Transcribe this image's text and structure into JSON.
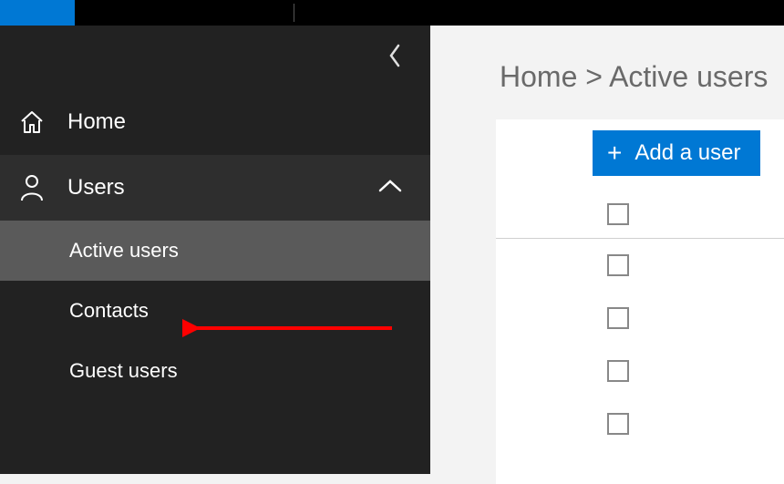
{
  "colors": {
    "accent": "#0078d4"
  },
  "sidebar": {
    "home_label": "Home",
    "users_label": "Users",
    "sub": {
      "active_users": "Active users",
      "contacts": "Contacts",
      "guest_users": "Guest users"
    }
  },
  "breadcrumb": {
    "home": "Home",
    "sep": ">",
    "current": "Active users"
  },
  "toolbar": {
    "add_user_label": "Add a user"
  }
}
